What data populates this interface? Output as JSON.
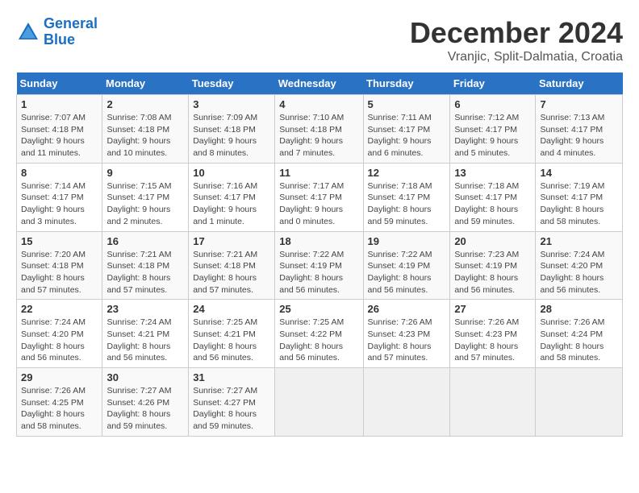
{
  "header": {
    "logo_line1": "General",
    "logo_line2": "Blue",
    "month": "December 2024",
    "location": "Vranjic, Split-Dalmatia, Croatia"
  },
  "days_of_week": [
    "Sunday",
    "Monday",
    "Tuesday",
    "Wednesday",
    "Thursday",
    "Friday",
    "Saturday"
  ],
  "weeks": [
    [
      {
        "day": "1",
        "sunrise": "7:07 AM",
        "sunset": "4:18 PM",
        "daylight": "9 hours and 11 minutes."
      },
      {
        "day": "2",
        "sunrise": "7:08 AM",
        "sunset": "4:18 PM",
        "daylight": "9 hours and 10 minutes."
      },
      {
        "day": "3",
        "sunrise": "7:09 AM",
        "sunset": "4:18 PM",
        "daylight": "9 hours and 8 minutes."
      },
      {
        "day": "4",
        "sunrise": "7:10 AM",
        "sunset": "4:18 PM",
        "daylight": "9 hours and 7 minutes."
      },
      {
        "day": "5",
        "sunrise": "7:11 AM",
        "sunset": "4:17 PM",
        "daylight": "9 hours and 6 minutes."
      },
      {
        "day": "6",
        "sunrise": "7:12 AM",
        "sunset": "4:17 PM",
        "daylight": "9 hours and 5 minutes."
      },
      {
        "day": "7",
        "sunrise": "7:13 AM",
        "sunset": "4:17 PM",
        "daylight": "9 hours and 4 minutes."
      }
    ],
    [
      {
        "day": "8",
        "sunrise": "7:14 AM",
        "sunset": "4:17 PM",
        "daylight": "9 hours and 3 minutes."
      },
      {
        "day": "9",
        "sunrise": "7:15 AM",
        "sunset": "4:17 PM",
        "daylight": "9 hours and 2 minutes."
      },
      {
        "day": "10",
        "sunrise": "7:16 AM",
        "sunset": "4:17 PM",
        "daylight": "9 hours and 1 minute."
      },
      {
        "day": "11",
        "sunrise": "7:17 AM",
        "sunset": "4:17 PM",
        "daylight": "9 hours and 0 minutes."
      },
      {
        "day": "12",
        "sunrise": "7:18 AM",
        "sunset": "4:17 PM",
        "daylight": "8 hours and 59 minutes."
      },
      {
        "day": "13",
        "sunrise": "7:18 AM",
        "sunset": "4:17 PM",
        "daylight": "8 hours and 59 minutes."
      },
      {
        "day": "14",
        "sunrise": "7:19 AM",
        "sunset": "4:17 PM",
        "daylight": "8 hours and 58 minutes."
      }
    ],
    [
      {
        "day": "15",
        "sunrise": "7:20 AM",
        "sunset": "4:18 PM",
        "daylight": "8 hours and 57 minutes."
      },
      {
        "day": "16",
        "sunrise": "7:21 AM",
        "sunset": "4:18 PM",
        "daylight": "8 hours and 57 minutes."
      },
      {
        "day": "17",
        "sunrise": "7:21 AM",
        "sunset": "4:18 PM",
        "daylight": "8 hours and 57 minutes."
      },
      {
        "day": "18",
        "sunrise": "7:22 AM",
        "sunset": "4:19 PM",
        "daylight": "8 hours and 56 minutes."
      },
      {
        "day": "19",
        "sunrise": "7:22 AM",
        "sunset": "4:19 PM",
        "daylight": "8 hours and 56 minutes."
      },
      {
        "day": "20",
        "sunrise": "7:23 AM",
        "sunset": "4:19 PM",
        "daylight": "8 hours and 56 minutes."
      },
      {
        "day": "21",
        "sunrise": "7:24 AM",
        "sunset": "4:20 PM",
        "daylight": "8 hours and 56 minutes."
      }
    ],
    [
      {
        "day": "22",
        "sunrise": "7:24 AM",
        "sunset": "4:20 PM",
        "daylight": "8 hours and 56 minutes."
      },
      {
        "day": "23",
        "sunrise": "7:24 AM",
        "sunset": "4:21 PM",
        "daylight": "8 hours and 56 minutes."
      },
      {
        "day": "24",
        "sunrise": "7:25 AM",
        "sunset": "4:21 PM",
        "daylight": "8 hours and 56 minutes."
      },
      {
        "day": "25",
        "sunrise": "7:25 AM",
        "sunset": "4:22 PM",
        "daylight": "8 hours and 56 minutes."
      },
      {
        "day": "26",
        "sunrise": "7:26 AM",
        "sunset": "4:23 PM",
        "daylight": "8 hours and 57 minutes."
      },
      {
        "day": "27",
        "sunrise": "7:26 AM",
        "sunset": "4:23 PM",
        "daylight": "8 hours and 57 minutes."
      },
      {
        "day": "28",
        "sunrise": "7:26 AM",
        "sunset": "4:24 PM",
        "daylight": "8 hours and 58 minutes."
      }
    ],
    [
      {
        "day": "29",
        "sunrise": "7:26 AM",
        "sunset": "4:25 PM",
        "daylight": "8 hours and 58 minutes."
      },
      {
        "day": "30",
        "sunrise": "7:27 AM",
        "sunset": "4:26 PM",
        "daylight": "8 hours and 59 minutes."
      },
      {
        "day": "31",
        "sunrise": "7:27 AM",
        "sunset": "4:27 PM",
        "daylight": "8 hours and 59 minutes."
      },
      null,
      null,
      null,
      null
    ]
  ]
}
